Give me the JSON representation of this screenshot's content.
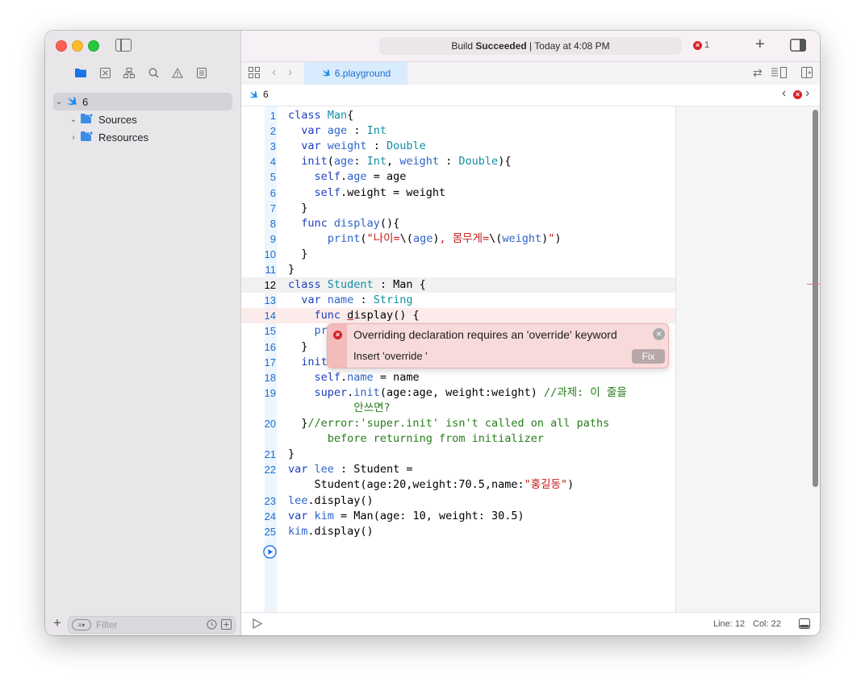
{
  "sidebar": {
    "tree": [
      {
        "label": "6",
        "expanded": true
      },
      {
        "label": "Sources",
        "expanded": true
      },
      {
        "label": "Resources",
        "expanded": false
      }
    ],
    "filter_placeholder": "Filter"
  },
  "toolbar": {
    "status_prefix": "Build ",
    "status_bold": "Succeeded",
    "status_suffix": " | Today at 4:08 PM",
    "error_count": "1"
  },
  "tabs": [
    {
      "label": "6.playground"
    }
  ],
  "jumpbar": {
    "label": "6"
  },
  "code_lines": [
    {
      "n": "1",
      "html": "<span class=\"kw\">class</span> <span class=\"ty\">Man</span>{"
    },
    {
      "n": "2",
      "html": "  <span class=\"kw\">var</span> <span class=\"prop\">age</span> : <span class=\"ty\">Int</span>"
    },
    {
      "n": "3",
      "html": "  <span class=\"kw\">var</span> <span class=\"prop\">weight</span> : <span class=\"ty\">Double</span>"
    },
    {
      "n": "4",
      "html": "  <span class=\"kw\">init</span>(<span class=\"prop\">age</span>: <span class=\"ty\">Int</span>, <span class=\"prop\">weight</span> : <span class=\"ty\">Double</span>){"
    },
    {
      "n": "5",
      "html": "    <span class=\"kw\">self</span>.<span class=\"prop\">age</span> = age"
    },
    {
      "n": "6",
      "html": "    <span class=\"kw\">self</span>.weight = weight"
    },
    {
      "n": "7",
      "html": "  }"
    },
    {
      "n": "8",
      "html": "  <span class=\"kw\">func</span> <span class=\"fn\">display</span>(){"
    },
    {
      "n": "9",
      "html": "      <span class=\"fn\">print</span>(<span class=\"str\">\"나이=</span>\\(<span class=\"prop\">age</span>)<span class=\"str\">, 몸무게=</span>\\(<span class=\"prop\">weight</span>)<span class=\"str\">\"</span>)"
    },
    {
      "n": "10",
      "html": "  }"
    },
    {
      "n": "11",
      "html": "}"
    },
    {
      "n": "12",
      "html": "<span class=\"kw\">class</span> <span class=\"ty\">Student</span> : Man {"
    },
    {
      "n": "13",
      "html": "  <span class=\"kw\">var</span> <span class=\"prop\">name</span> : <span class=\"ty\">String</span>"
    },
    {
      "n": "14",
      "html": "    <span class=\"kw\">func</span> <span style=\"text-decoration:underline;text-decoration-color:#d8232a;\">d</span>isplay() {"
    },
    {
      "n": "15",
      "html": "    <span class=\"fn\">pr</span>"
    },
    {
      "n": "16",
      "html": "  }"
    },
    {
      "n": "17",
      "html": "  <span class=\"kw\">init</span>"
    },
    {
      "n": "18",
      "html": "    <span class=\"kw\">self</span>.<span class=\"prop\">name</span> = name"
    },
    {
      "n": "19",
      "html": "    <span class=\"kw\">super</span>.<span class=\"fn\">init</span>(age:age, weight:weight) <span class=\"cmt\">//과제: 이 줄을</span>"
    },
    {
      "n": "",
      "html": "          <span class=\"cmt\">안쓰면?</span>"
    },
    {
      "n": "20",
      "html": "  }<span class=\"cmt\">//error:'super.init' isn't called on all paths</span>"
    },
    {
      "n": "",
      "html": "      <span class=\"cmt\">before returning from initializer</span>"
    },
    {
      "n": "21",
      "html": "}"
    },
    {
      "n": "22",
      "html": "<span class=\"kw\">var</span> <span class=\"prop\">lee</span> : Student ="
    },
    {
      "n": "",
      "html": "    Student(age:20,weight:70.5,name:<span class=\"str\">\"홍길동\"</span>)"
    },
    {
      "n": "23",
      "html": "<span class=\"prop\">lee</span>.display()"
    },
    {
      "n": "24",
      "html": "<span class=\"kw\">var</span> <span class=\"prop\">kim</span> = Man(age: 10, weight: 30.5)"
    },
    {
      "n": "25",
      "html": "<span class=\"prop\">kim</span>.display()"
    }
  ],
  "error_popup": {
    "message": "Overriding declaration requires an 'override' keyword",
    "fixit": "Insert 'override '",
    "fix_button": "Fix"
  },
  "bottombar": {
    "line_label": "Line: 12",
    "col_label": "Col: 22"
  },
  "colors": {
    "accent": "#1a73e8",
    "error": "#d8232a"
  }
}
